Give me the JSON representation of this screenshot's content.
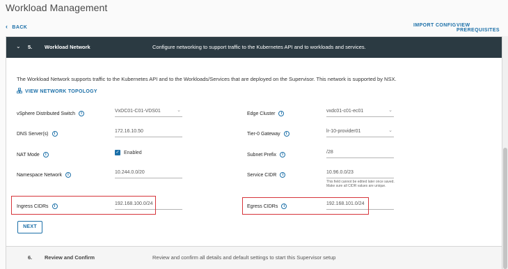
{
  "page": {
    "title": "Workload Management"
  },
  "nav": {
    "back_label": "BACK",
    "import_config": "IMPORT CONFIG",
    "view_prerequisites": "VIEW PREREQUISITES"
  },
  "step5": {
    "number": "5.",
    "name": "Workload Network",
    "description": "Configure networking to support traffic to the Kubernetes API and to workloads and services."
  },
  "intro_text": "The Workload Network supports traffic to the Kubernetes API and to the Workloads/Services that are deployed on the Supervisor. This network is supported by NSX.",
  "topology_link": "VIEW NETWORK TOPOLOGY",
  "left_fields": {
    "vds": {
      "label": "vSphere Distributed Switch",
      "value": "VxDC01-C01-VDS01"
    },
    "dns": {
      "label": "DNS Server(s)",
      "value": "172.16.10.50"
    },
    "nat": {
      "label": "NAT Mode",
      "value": "Enabled"
    },
    "namespace": {
      "label": "Namespace Network",
      "value": "10.244.0.0/20"
    },
    "ingress": {
      "label": "Ingress CIDRs",
      "value": "192.168.100.0/24"
    }
  },
  "right_fields": {
    "edge": {
      "label": "Edge Cluster",
      "value": "vxdc01-c01-ec01"
    },
    "tier0": {
      "label": "Tier-0 Gateway",
      "value": "lr-10-provider01"
    },
    "subnet": {
      "label": "Subnet Prefix",
      "value": "/28"
    },
    "service": {
      "label": "Service CIDR",
      "value": "10.96.0.0/23",
      "help": "This field cannot be edited later once saved. Make sure all CIDR values are unique."
    },
    "egress": {
      "label": "Egress CIDRs",
      "value": "192.168.101.0/24"
    }
  },
  "next_button": "NEXT",
  "step6": {
    "number": "6.",
    "name": "Review and Confirm",
    "description": "Review and confirm all details and default settings to start this Supervisor setup"
  },
  "colors": {
    "accent": "#1b6fa8",
    "header_bg": "#2b3a42",
    "highlight": "#d6343a"
  }
}
